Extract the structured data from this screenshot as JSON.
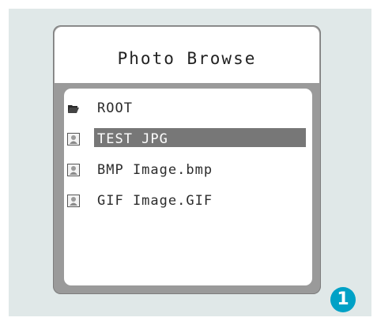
{
  "screen": {
    "title": "Photo Browse"
  },
  "file_list": {
    "items": [
      {
        "label": "ROOT",
        "icon": "folder-icon",
        "selected": false
      },
      {
        "label": "TEST JPG",
        "icon": "image-file-icon",
        "selected": true
      },
      {
        "label": "BMP Image.bmp",
        "icon": "image-file-icon",
        "selected": false
      },
      {
        "label": "GIF Image.GIF",
        "icon": "image-file-icon",
        "selected": false
      }
    ]
  },
  "step_badge": {
    "number": "1",
    "color": "#00a1c6"
  }
}
